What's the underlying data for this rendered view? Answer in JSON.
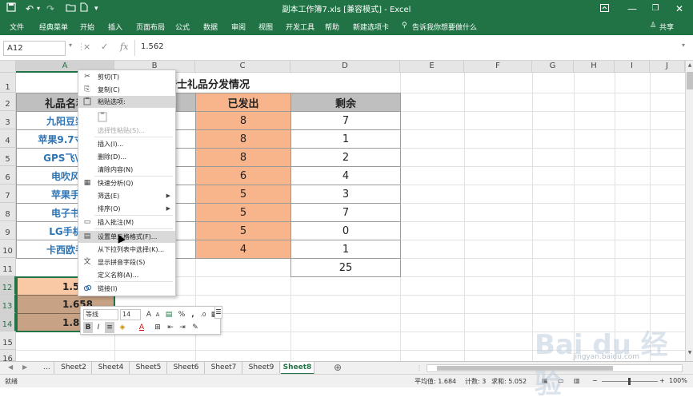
{
  "window": {
    "title": "副本工作簿7.xls  [兼容模式]  -  Excel"
  },
  "quick_access": {
    "save": "save-icon",
    "undo": "undo-icon",
    "redo": "redo-icon",
    "open": "folder-icon",
    "qa_extra": "file-icon",
    "customize": "▾"
  },
  "ribbon": {
    "tabs": [
      "文件",
      "经典菜单",
      "开始",
      "插入",
      "页面布局",
      "公式",
      "数据",
      "审阅",
      "视图",
      "开发工具",
      "帮助",
      "新建选项卡"
    ],
    "tell_me": "告诉我你想要做什么",
    "share": "共享"
  },
  "formula_bar": {
    "name_box": "A12",
    "cancel": "×",
    "enter": "✓",
    "fx": "fx",
    "value": "1.562"
  },
  "columns": [
    "A",
    "B",
    "C",
    "D",
    "E",
    "F",
    "G",
    "H",
    "I",
    "J"
  ],
  "rows": [
    "1",
    "2",
    "3",
    "4",
    "5",
    "6",
    "7",
    "8",
    "9",
    "10",
    "11",
    "12",
    "13",
    "14",
    "15",
    "16"
  ],
  "sheet": {
    "title": "骑士礼品分发情况",
    "headers": {
      "a": "礼品名称",
      "c": "已发出",
      "d": "剩余"
    },
    "gifts": [
      "九阳豆浆",
      "苹果9.7寸平",
      "GPS飞\\导",
      "电吹风",
      "苹果手",
      "电子书",
      "LG手机",
      "卡西欧手"
    ],
    "sent": [
      "8",
      "8",
      "8",
      "6",
      "5",
      "5",
      "5",
      "4"
    ],
    "remaining": [
      "7",
      "1",
      "2",
      "4",
      "3",
      "7",
      "0",
      "1"
    ],
    "total_remaining": "25",
    "selected_values": [
      "1.562",
      "1.658",
      "1.832"
    ]
  },
  "context_menu": [
    {
      "label": "剪切(T)",
      "icon": "scissors-icon",
      "glyph": "✂"
    },
    {
      "label": "复制(C)",
      "icon": "copy-icon",
      "glyph": "⎘"
    },
    {
      "label": "粘贴选项:",
      "icon": "paste-options-icon",
      "glyph": ""
    },
    {
      "label": "",
      "icon": "clipboard-icon",
      "glyph": "📋"
    },
    {
      "label": "选择性粘贴(S)...",
      "icon": "",
      "glyph": ""
    },
    {
      "label": "插入(I)...",
      "icon": "",
      "glyph": ""
    },
    {
      "label": "删除(D)...",
      "icon": "",
      "glyph": ""
    },
    {
      "label": "清除内容(N)",
      "icon": "",
      "glyph": ""
    },
    {
      "label": "快速分析(Q)",
      "icon": "quick-analysis-icon",
      "glyph": "▦"
    },
    {
      "label": "筛选(E)",
      "icon": "",
      "glyph": ""
    },
    {
      "label": "排序(O)",
      "icon": "",
      "glyph": ""
    },
    {
      "label": "插入批注(M)",
      "icon": "comment-icon",
      "glyph": "▭"
    },
    {
      "label": "设置单元格格式(F)...",
      "icon": "format-cells-icon",
      "glyph": "▤"
    },
    {
      "label": "从下拉列表中选择(K)...",
      "icon": "",
      "glyph": ""
    },
    {
      "label": "显示拼音字段(S)",
      "icon": "phonetic-icon",
      "glyph": "文"
    },
    {
      "label": "定义名称(A)...",
      "icon": "",
      "glyph": ""
    },
    {
      "label": "链接(I)",
      "icon": "link-icon",
      "glyph": "🔗"
    }
  ],
  "mini_toolbar": {
    "font": "等线",
    "size": "14",
    "grow": "A",
    "shrink": "A",
    "percent": "%",
    "comma": ",",
    "bold": "B",
    "italic": "I",
    "font_color": "A"
  },
  "sheet_tabs": [
    "...",
    "Sheet2",
    "Sheet4",
    "Sheet5",
    "Sheet6",
    "Sheet7",
    "Sheet9",
    "Sheet8"
  ],
  "active_sheet": "Sheet8",
  "status_bar": {
    "mode": "就绪",
    "average": "平均值: 1.684",
    "count": "计数: 3",
    "sum": "求和: 5.052",
    "zoom": "100%"
  },
  "watermark": {
    "text": "Bai du 经验",
    "sub": "jingyan.baidu.com"
  }
}
